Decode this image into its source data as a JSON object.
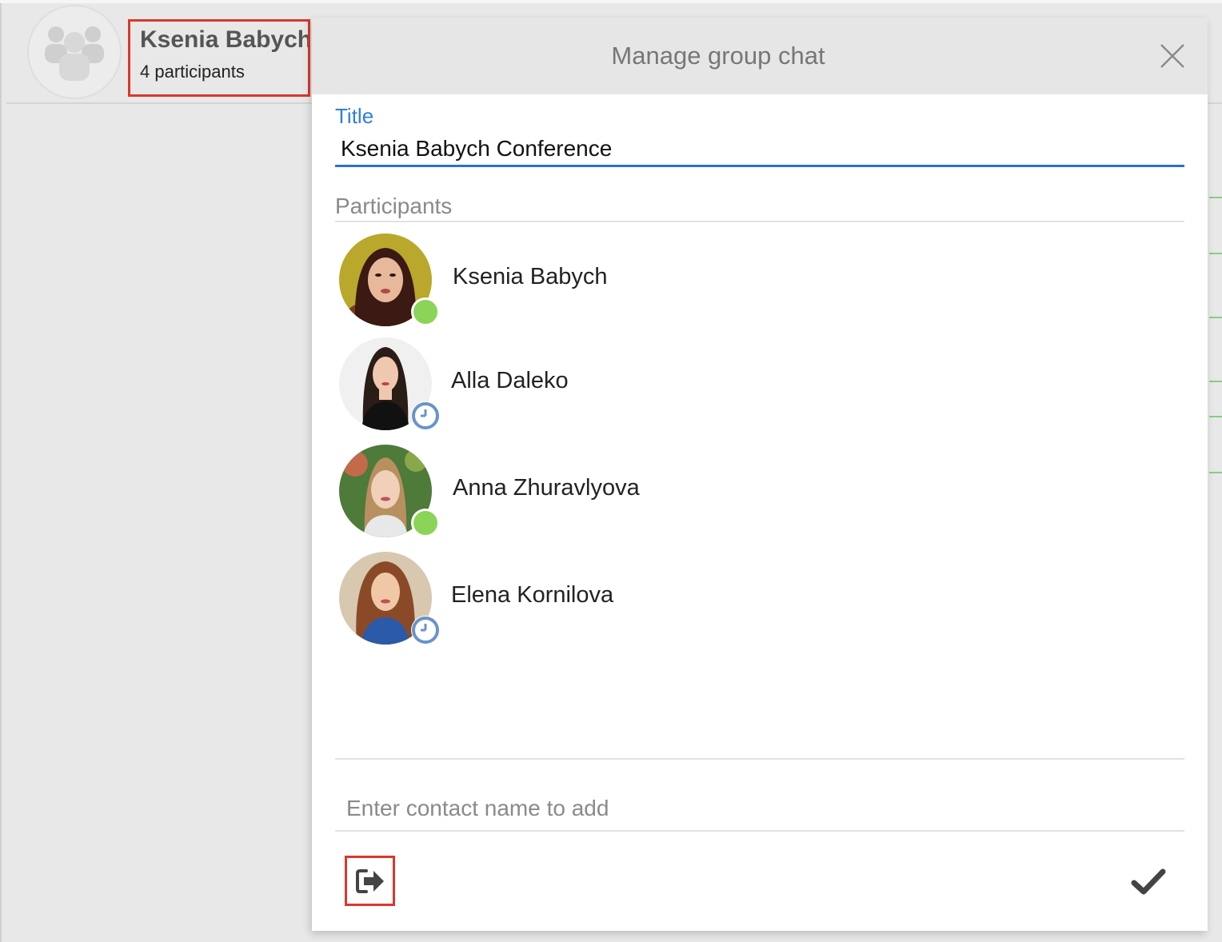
{
  "chat_header": {
    "name": "Ksenia Babych",
    "participants_count": "4 participants"
  },
  "dialog": {
    "title": "Manage group chat",
    "title_label": "Title",
    "title_value": "Ksenia Babych Conference",
    "participants_label": "Participants",
    "participants": [
      {
        "name": "Ksenia Babych",
        "status": "online"
      },
      {
        "name": "Alla Daleko",
        "status": "away"
      },
      {
        "name": "Anna Zhuravlyova",
        "status": "online"
      },
      {
        "name": "Elena Kornilova",
        "status": "away"
      }
    ],
    "add_contact_placeholder": "Enter contact name to add"
  },
  "icons": {
    "group": "group-icon",
    "close": "close-icon",
    "leave": "leave-chat-icon",
    "confirm": "checkmark-icon",
    "status_away": "clock-icon"
  },
  "colors": {
    "accent": "#2f7fd8",
    "online": "#8bd457",
    "away": "#6a93c9",
    "highlight": "#d9382c"
  }
}
